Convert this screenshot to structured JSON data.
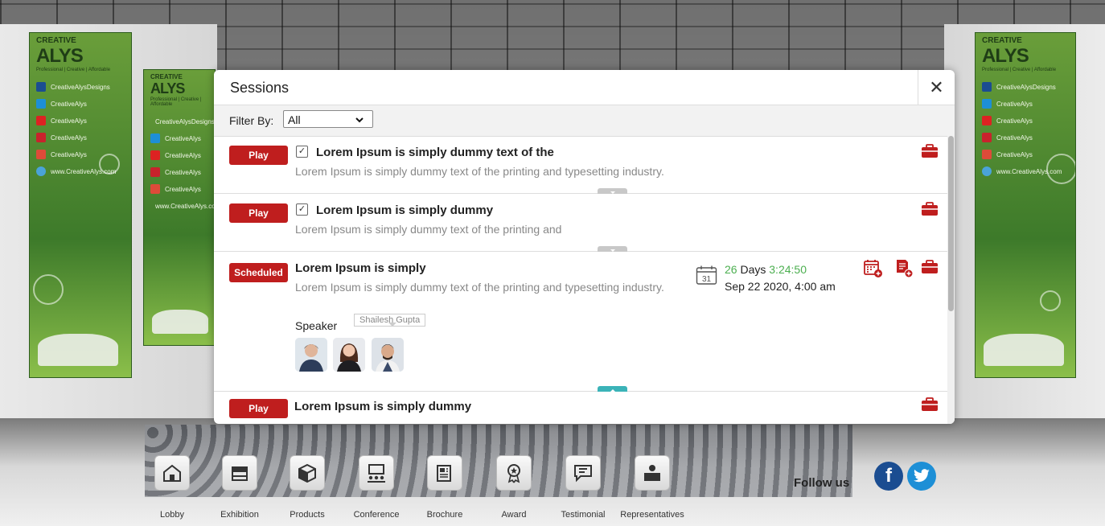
{
  "modal": {
    "title": "Sessions",
    "close_glyph": "✕",
    "filter": {
      "label": "Filter By:",
      "selected": "All"
    }
  },
  "sessions": [
    {
      "button": "Play",
      "checked": true,
      "title": "Lorem Ipsum is simply dummy text of the",
      "description": "Lorem Ipsum is simply dummy text of the printing and typesetting industry."
    },
    {
      "button": "Play",
      "checked": true,
      "title": "Lorem Ipsum is simply dummy",
      "description": "Lorem Ipsum is simply dummy text of the printing and"
    },
    {
      "button": "Scheduled",
      "title": "Lorem Ipsum is simply",
      "description": "Lorem Ipsum is simply dummy text of the printing and typesetting industry.",
      "countdown": {
        "days": "26",
        "days_label": "Days",
        "time": "3:24:50"
      },
      "date": "Sep 22 2020, 4:00 am",
      "calendar_day": "31",
      "speaker_label": "Speaker",
      "speaker_tooltip": "Shailesh Gupta"
    },
    {
      "button": "Play",
      "title": "Lorem Ipsum is simply dummy"
    }
  ],
  "banners": {
    "brand_top": "CREATIVE",
    "brand_main": "ALYS",
    "tagline": "Professional | Creative | Affordable",
    "socials": [
      "CreativeAlysDesigns",
      "CreativeAlys",
      "CreativeAlys",
      "CreativeAlys",
      "CreativeAlys",
      "www.CreativeAlys.com"
    ]
  },
  "nav": [
    {
      "label": "Lobby",
      "icon": "lobby-icon"
    },
    {
      "label": "Exhibition",
      "icon": "exhibition-icon"
    },
    {
      "label": "Products",
      "icon": "products-icon"
    },
    {
      "label": "Conference",
      "icon": "conference-icon"
    },
    {
      "label": "Brochure",
      "icon": "brochure-icon"
    },
    {
      "label": "Award",
      "icon": "award-icon"
    },
    {
      "label": "Testimonial",
      "icon": "testimonial-icon"
    },
    {
      "label": "Representatives",
      "icon": "representatives-icon"
    }
  ],
  "follow": {
    "label": "Follow us",
    "facebook": "f",
    "twitter": "t"
  },
  "colors": {
    "accent_red": "#bf1e1e",
    "countdown_green": "#4caf50",
    "expand_teal": "#3bb3b8",
    "banner_green": "#3d7a2a",
    "facebook": "#1b4d91",
    "twitter": "#1d8fd6"
  }
}
